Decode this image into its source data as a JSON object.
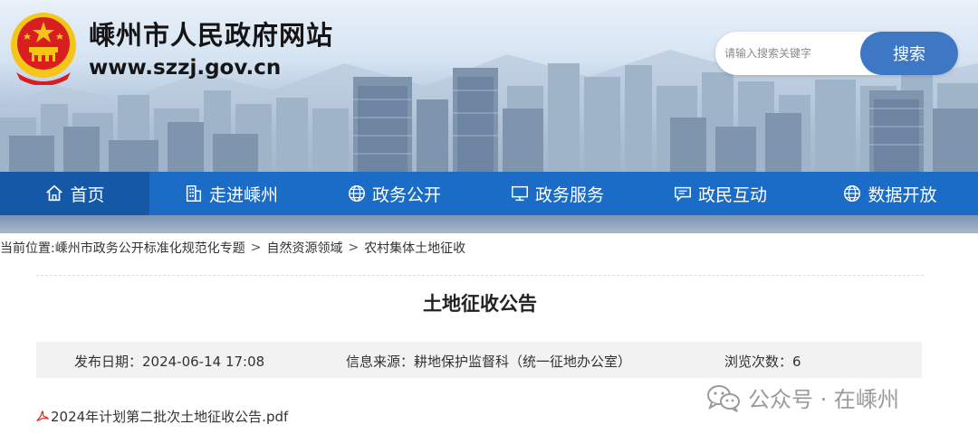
{
  "header": {
    "site_title": "嵊州市人民政府网站",
    "site_url": "www.szzj.gov.cn"
  },
  "search": {
    "placeholder": "请输入搜索关键字",
    "button_label": "搜索"
  },
  "nav": {
    "items": [
      {
        "label": "首页",
        "icon": "home-icon",
        "active": true
      },
      {
        "label": "走进嵊州",
        "icon": "building-icon"
      },
      {
        "label": "政务公开",
        "icon": "globe-icon"
      },
      {
        "label": "政务服务",
        "icon": "monitor-icon"
      },
      {
        "label": "政民互动",
        "icon": "chat-icon"
      },
      {
        "label": "数据开放",
        "icon": "globe-icon"
      }
    ]
  },
  "breadcrumb": {
    "prefix": "当前位置:",
    "items": [
      "嵊州市政务公开标准化规范化专题",
      "自然资源领域",
      "农村集体土地征收"
    ],
    "separator": ">"
  },
  "article": {
    "title": "土地征收公告",
    "publish_date": "发布日期：2024-06-14 17:08",
    "source": "信息来源：耕地保护监督科（统一征地办公室）",
    "views": "浏览次数：6",
    "attachment": "2024年计划第二批次土地征收公告.pdf"
  },
  "watermark": {
    "text": "公众号 · 在嵊州"
  },
  "colors": {
    "nav_bg": "#1a6cc7",
    "nav_active": "#1558a8",
    "search_button": "#3e78c4",
    "emblem_red": "#d81e1e",
    "emblem_gold": "#f5c518"
  }
}
